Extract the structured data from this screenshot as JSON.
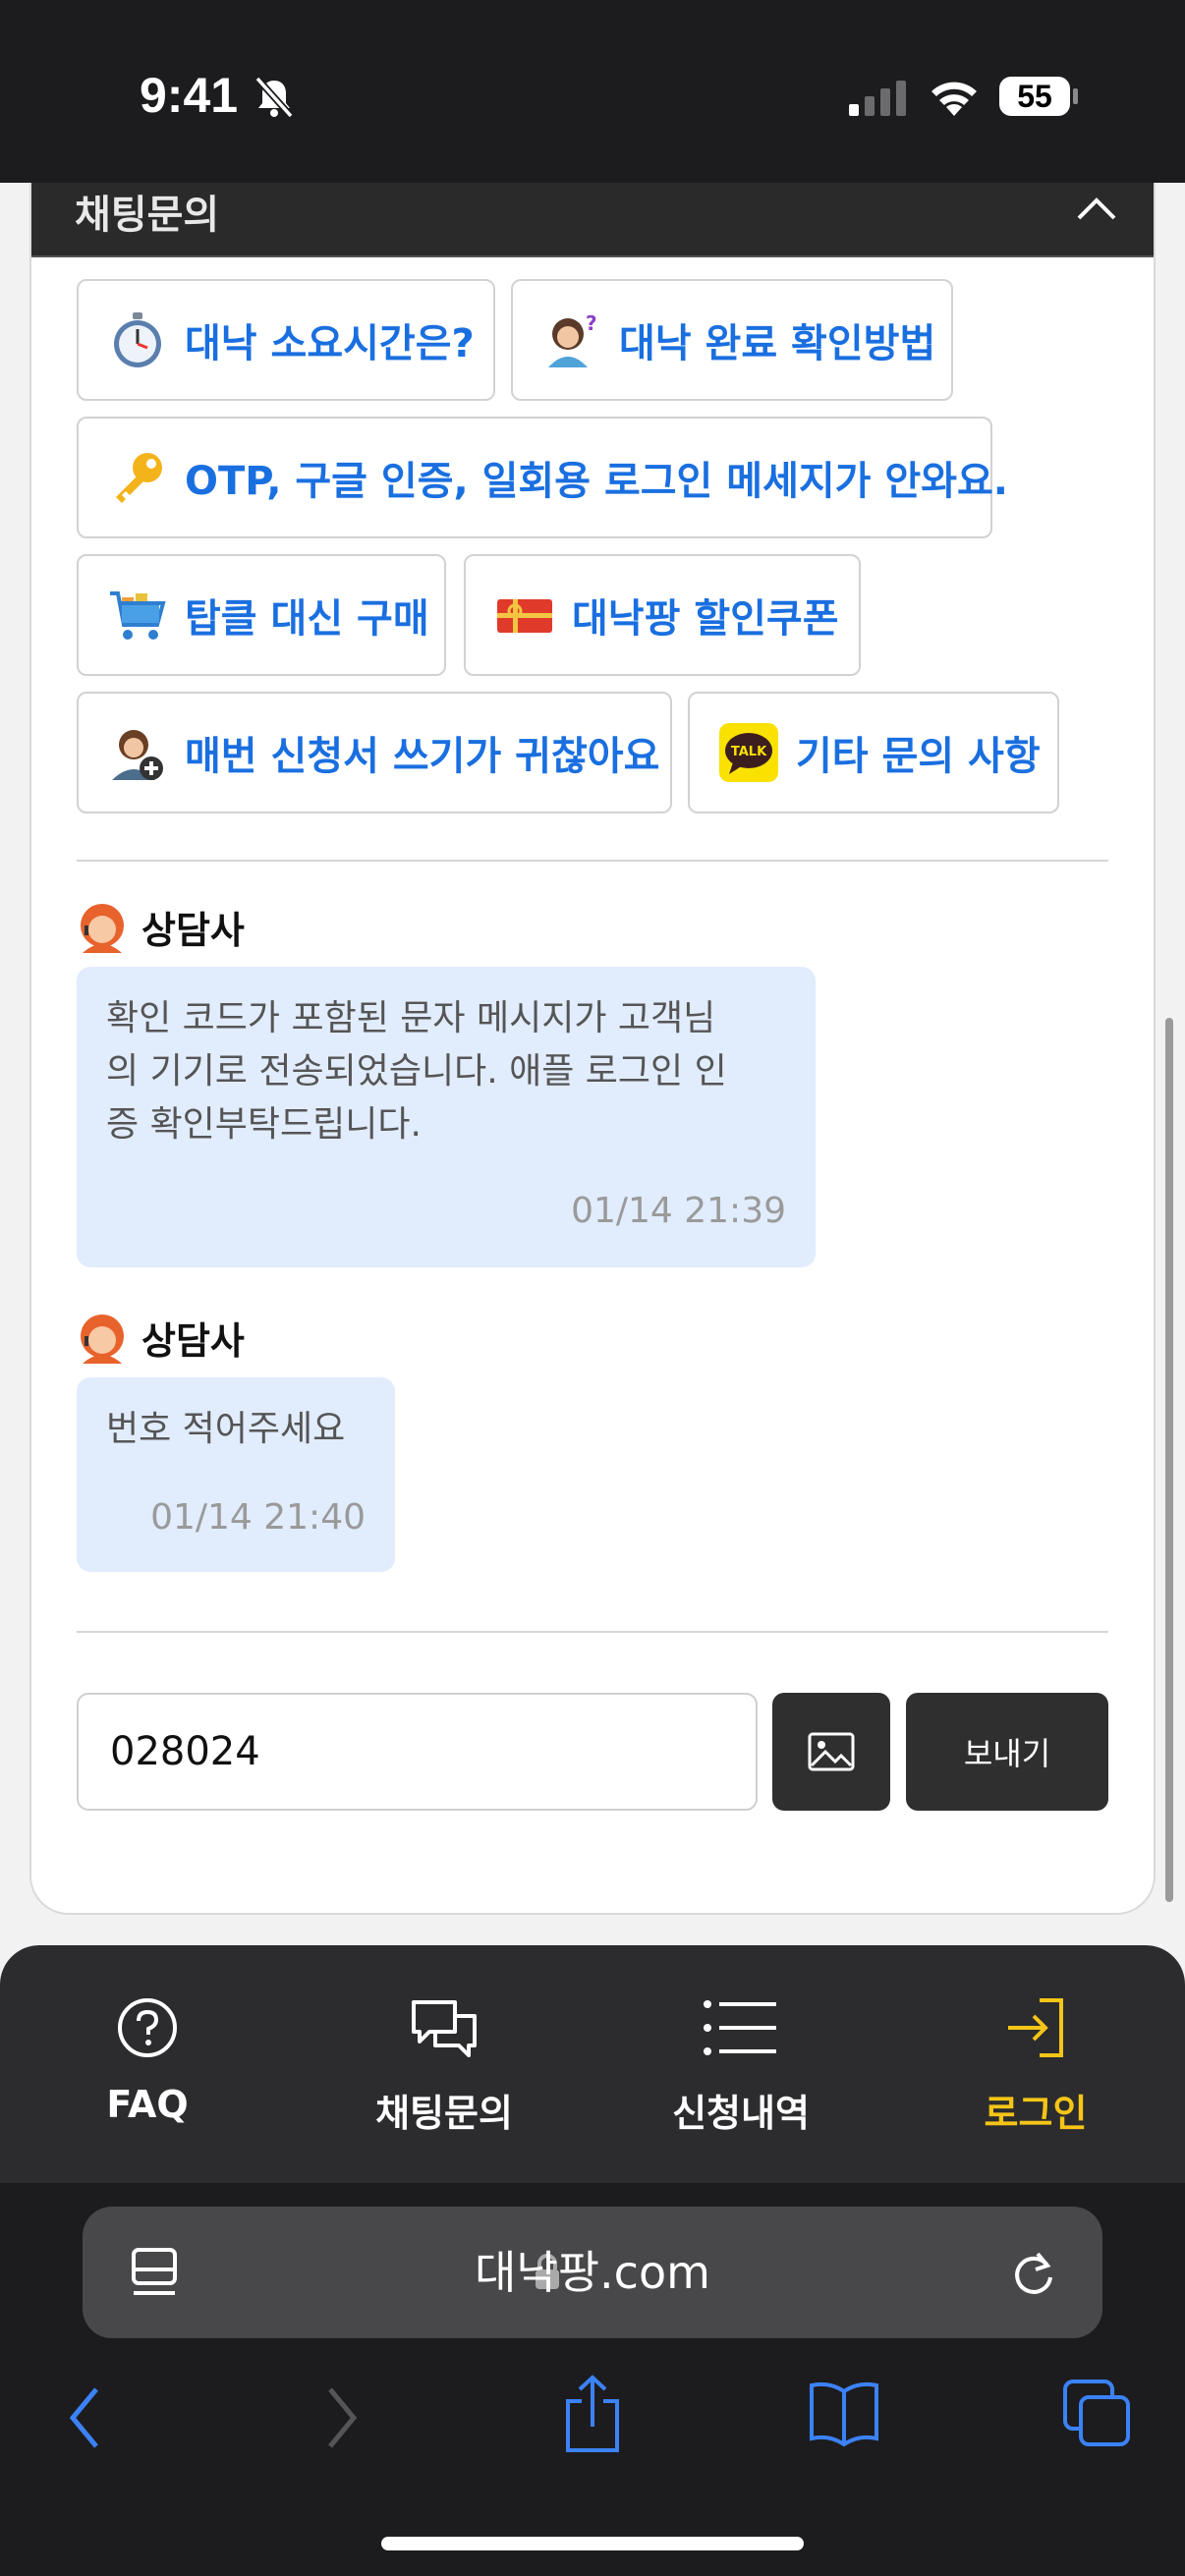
{
  "status_bar": {
    "time": "9:41",
    "battery": "55"
  },
  "header": {
    "title": "채팅문의"
  },
  "quick_buttons": [
    {
      "label": "대낙 소요시간은?",
      "icon": "stopwatch-icon"
    },
    {
      "label": "대낙 완료 확인방법",
      "icon": "person-question-icon"
    },
    {
      "label": "OTP, 구글 인증, 일회용 로그인 메세지가 안와요.",
      "icon": "key-icon"
    },
    {
      "label": "탑클 대신 구매",
      "icon": "shopping-cart-icon"
    },
    {
      "label": "대낙팡 할인쿠폰",
      "icon": "gift-card-icon"
    },
    {
      "label": "매번 신청서 쓰기가 귀찮아요",
      "icon": "person-add-icon"
    },
    {
      "label": "기타 문의 사항",
      "icon": "kakaotalk-icon"
    }
  ],
  "kakao_icon_text": "TALK",
  "messages": [
    {
      "sender": "상담사",
      "lines": [
        "확인 코드가 포함된 문자 메시지가 고객님",
        "의 기기로 전송되었습니다. 애플 로그인 인",
        "증 확인부탁드립니다."
      ],
      "time": "01/14 21:39"
    },
    {
      "sender": "상담사",
      "lines": [
        "번호 적어주세요"
      ],
      "time": "01/14 21:40"
    }
  ],
  "composer": {
    "value": "028024",
    "send_label": "보내기"
  },
  "site_nav": [
    {
      "label": "FAQ",
      "icon": "question-circle-icon"
    },
    {
      "label": "채팅문의",
      "icon": "chat-bubbles-icon"
    },
    {
      "label": "신청내역",
      "icon": "list-icon"
    },
    {
      "label": "로그인",
      "icon": "login-icon",
      "active": true
    }
  ],
  "browser": {
    "url": "대낙팡.com"
  },
  "colors": {
    "link_blue": "#1a6fe0",
    "bubble_bg": "#e1ecfd",
    "active_nav": "#f5c518",
    "dark": "#2f2f2f"
  }
}
